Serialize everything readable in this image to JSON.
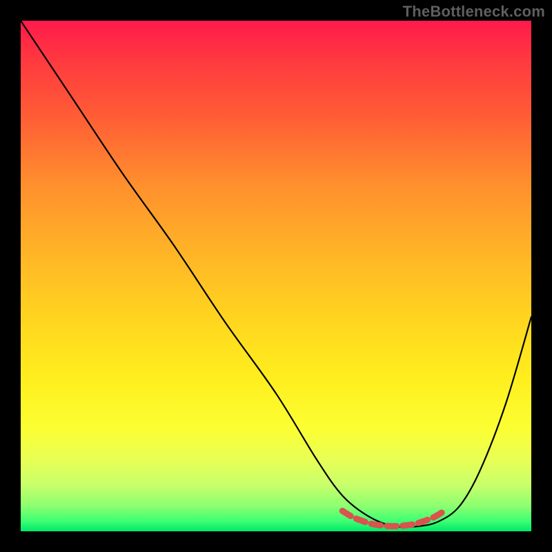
{
  "watermark": "TheBottleneck.com",
  "chart_data": {
    "type": "line",
    "title": "",
    "xlabel": "",
    "ylabel": "",
    "xlim": [
      0,
      100
    ],
    "ylim": [
      0,
      100
    ],
    "grid": false,
    "legend": false,
    "series": [
      {
        "name": "bottleneck-curve",
        "color": "#000000",
        "x": [
          0,
          10,
          20,
          30,
          40,
          50,
          58,
          63,
          68,
          73,
          78,
          82,
          86,
          90,
          95,
          100
        ],
        "y": [
          100,
          85,
          70,
          56,
          41,
          27,
          14,
          7,
          3,
          1,
          1,
          2,
          5,
          12,
          25,
          42
        ]
      },
      {
        "name": "optimal-zone-marker",
        "color": "#d9534f",
        "x": [
          63,
          65,
          67,
          69,
          71,
          73,
          75,
          77,
          79,
          81,
          83
        ],
        "y": [
          4.0,
          2.8,
          2.0,
          1.4,
          1.1,
          1.0,
          1.1,
          1.4,
          2.0,
          2.8,
          4.0
        ]
      }
    ],
    "background_gradient": {
      "top": "#ff1a4b",
      "mid": "#ffd41f",
      "bottom": "#00e86a"
    }
  }
}
